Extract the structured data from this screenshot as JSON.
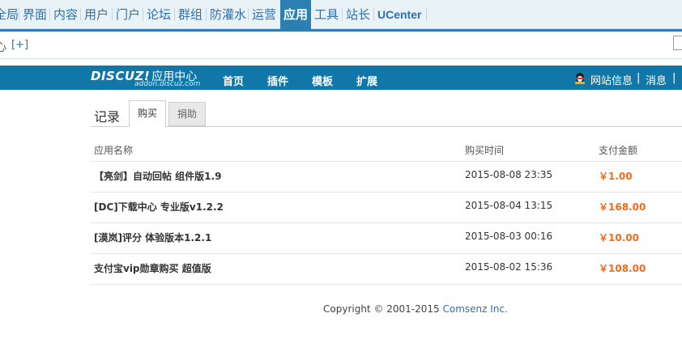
{
  "topnav": {
    "items": [
      "全局",
      "界面",
      "内容",
      "用户",
      "门户",
      "论坛",
      "群组",
      "防灌水",
      "运营",
      "应用",
      "工具",
      "站长",
      "UCenter"
    ],
    "active": "应用"
  },
  "subnav": {
    "partial_text": "心",
    "add_label": "[+]"
  },
  "appcenter": {
    "brand": "DISCUZ!",
    "title": "应用中心",
    "domain": "addon.discuz.com",
    "nav": [
      "首页",
      "插件",
      "模板",
      "扩展"
    ],
    "site_info": "网站信息",
    "divider": "|",
    "messages": "消息",
    "trailing_divider": "|"
  },
  "tabs": {
    "record": "记录",
    "buy": "购买",
    "donate": "捐助"
  },
  "table": {
    "headers": [
      "应用名称",
      "购买时间",
      "支付金额"
    ],
    "rows": [
      {
        "name": "【亮剑】自动回帖 组件版1.9",
        "time": "2015-08-08 23:35",
        "amount": "￥1.00"
      },
      {
        "name": "[DC]下载中心 专业版v1.2.2",
        "time": "2015-08-04 13:15",
        "amount": "￥168.00"
      },
      {
        "name": "[漠岚]评分 体验版本1.2.1",
        "time": "2015-08-03 00:16",
        "amount": "￥10.00"
      },
      {
        "name": "支付宝vip勋章购买 超值版",
        "time": "2015-08-02 15:36",
        "amount": "￥108.00"
      }
    ]
  },
  "footer": {
    "copyright": "Copyright © 2001-2015",
    "company": "Comsenz Inc."
  },
  "colors": {
    "accent": "#2b7fb3",
    "appbar": "#1077a8",
    "amount": "#f26c1a"
  }
}
